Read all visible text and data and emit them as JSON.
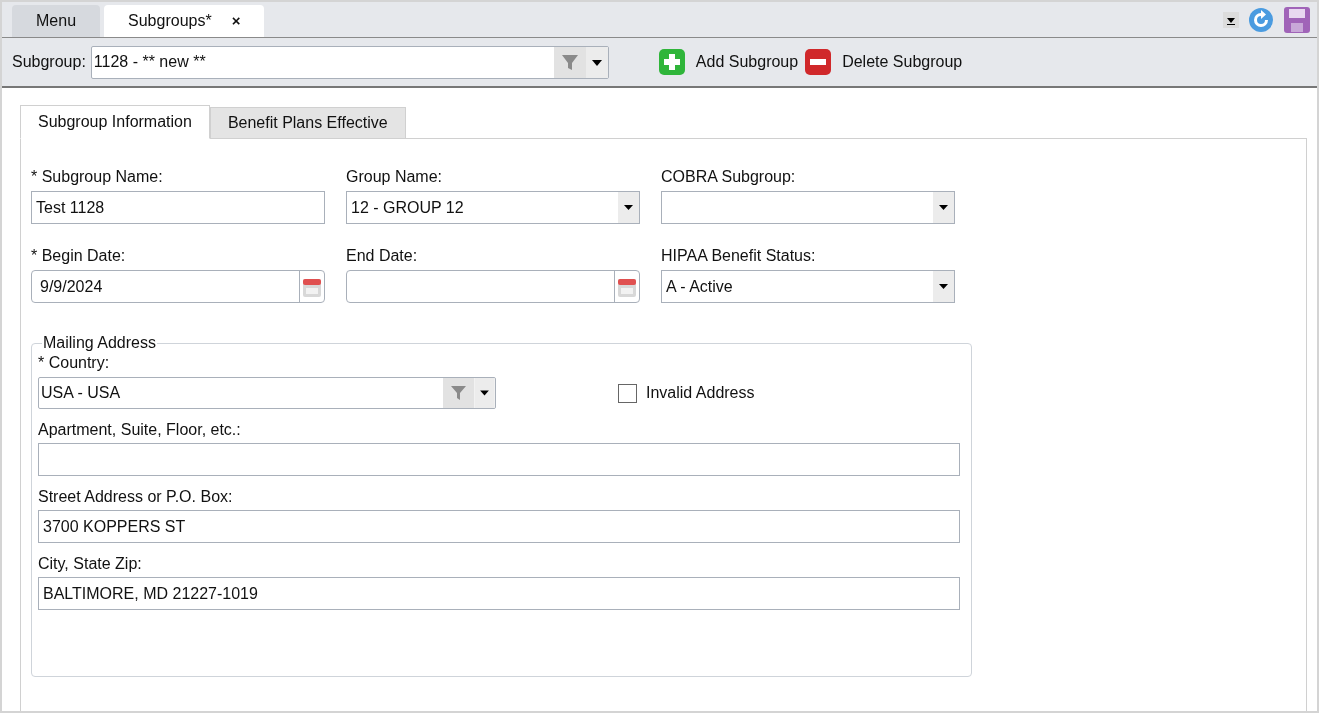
{
  "doc_tabs": [
    {
      "label": "Menu",
      "selected": false
    },
    {
      "label": "Subgroups*",
      "selected": true,
      "close_glyph": "×"
    }
  ],
  "toolbar": {
    "label": "Subgroup:",
    "value": "1128 - ** new **",
    "actions": [
      {
        "kind": "add",
        "label": "Add Subgroup"
      },
      {
        "kind": "delete",
        "label": "Delete Subgroup"
      }
    ]
  },
  "tabs": [
    {
      "label": "Subgroup Information",
      "selected": true
    },
    {
      "label": "Benefit Plans Effective",
      "selected": false
    }
  ],
  "fields": [
    {
      "kind": "text",
      "label": "* Subgroup Name:",
      "value": "Test 1128"
    },
    {
      "kind": "dropdown",
      "label": "Group Name:",
      "value": "12 - GROUP 12"
    },
    {
      "kind": "dropdown",
      "label": "COBRA Subgroup:"
    },
    {
      "kind": "date",
      "label": "* Begin Date:",
      "value": "9/9/2024"
    },
    {
      "kind": "date",
      "label": "End Date:"
    },
    {
      "kind": "dropdown",
      "label": "HIPAA Benefit Status:",
      "value": "A - Active"
    }
  ],
  "mailing_address": {
    "title": "Mailing Address",
    "country": {
      "label": "* Country:",
      "value": "USA - USA"
    },
    "invalid_address": {
      "label": "Invalid Address",
      "checked": false
    },
    "fields": [
      {
        "label": "Apartment, Suite, Floor, etc.:"
      },
      {
        "label": "Street Address or P.O. Box:",
        "value": "3700 KOPPERS ST"
      },
      {
        "label": "City, State Zip:",
        "value": "BALTIMORE, MD 21227-1019"
      }
    ]
  }
}
